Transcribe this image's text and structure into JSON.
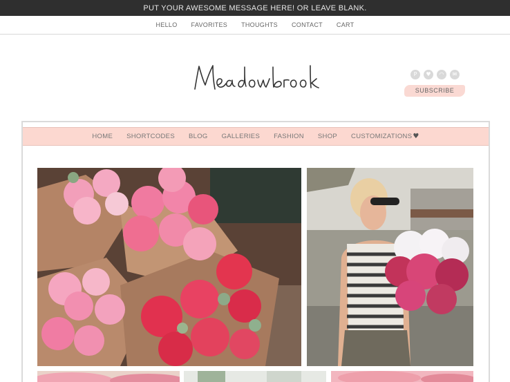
{
  "announcement": "PUT YOUR AWESOME MESSAGE HERE! OR LEAVE BLANK.",
  "top_nav": [
    "HELLO",
    "FAVORITES",
    "THOUGHTS",
    "CONTACT",
    "CART"
  ],
  "logo": {
    "text": "Meadowbrook"
  },
  "social_icons": [
    "pinterest-icon",
    "heart-icon",
    "rss-icon",
    "email-icon"
  ],
  "subscribe_label": "SUBSCRIBE",
  "main_nav": [
    "HOME",
    "SHORTCODES",
    "BLOG",
    "GALLERIES",
    "FASHION",
    "SHOP",
    "CUSTOMIZATIONS"
  ],
  "main_nav_heart": "♥",
  "colors": {
    "accent_pink": "#fcd8d0",
    "topbar": "#2f2f2f",
    "subscribe_bg": "#fad9d3"
  },
  "photos": [
    "pink-ranunculus-bouquets-photo",
    "woman-holding-flowers-photo",
    "pink-flowers-photo",
    "window-photo",
    "pink-rose-photo"
  ]
}
